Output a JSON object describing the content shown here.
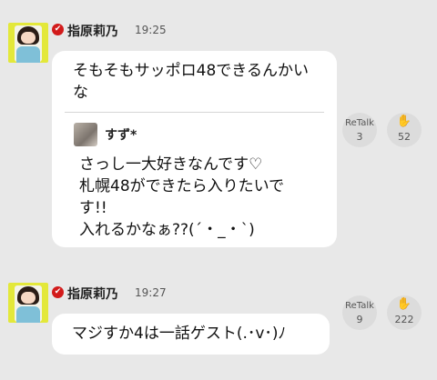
{
  "posts": [
    {
      "author": "指原莉乃",
      "time": "19:25",
      "text": "そもそもサッポロ48できるんかい\nな",
      "quote": {
        "author": "すず*",
        "text": "さっし一大好きなんです♡\n札幌48ができたら入りたいで\nす!!\n入れるかなぁ??(´・_・`)"
      },
      "retalk_label": "ReTalk",
      "retalk_count": "3",
      "clap_count": "52"
    },
    {
      "author": "指原莉乃",
      "time": "19:27",
      "text": "マジすか4は一話ゲスト(.･v･)ﾉ",
      "retalk_label": "ReTalk",
      "retalk_count": "9",
      "clap_count": "222"
    }
  ],
  "icons": {
    "verified": "verified-check-icon",
    "clap": "clap-hands-icon"
  },
  "colors": {
    "badge": "#d21a1a",
    "avatar_bg": "#e3e83a",
    "bubble": "#ffffff",
    "background": "#e8e8e8"
  }
}
